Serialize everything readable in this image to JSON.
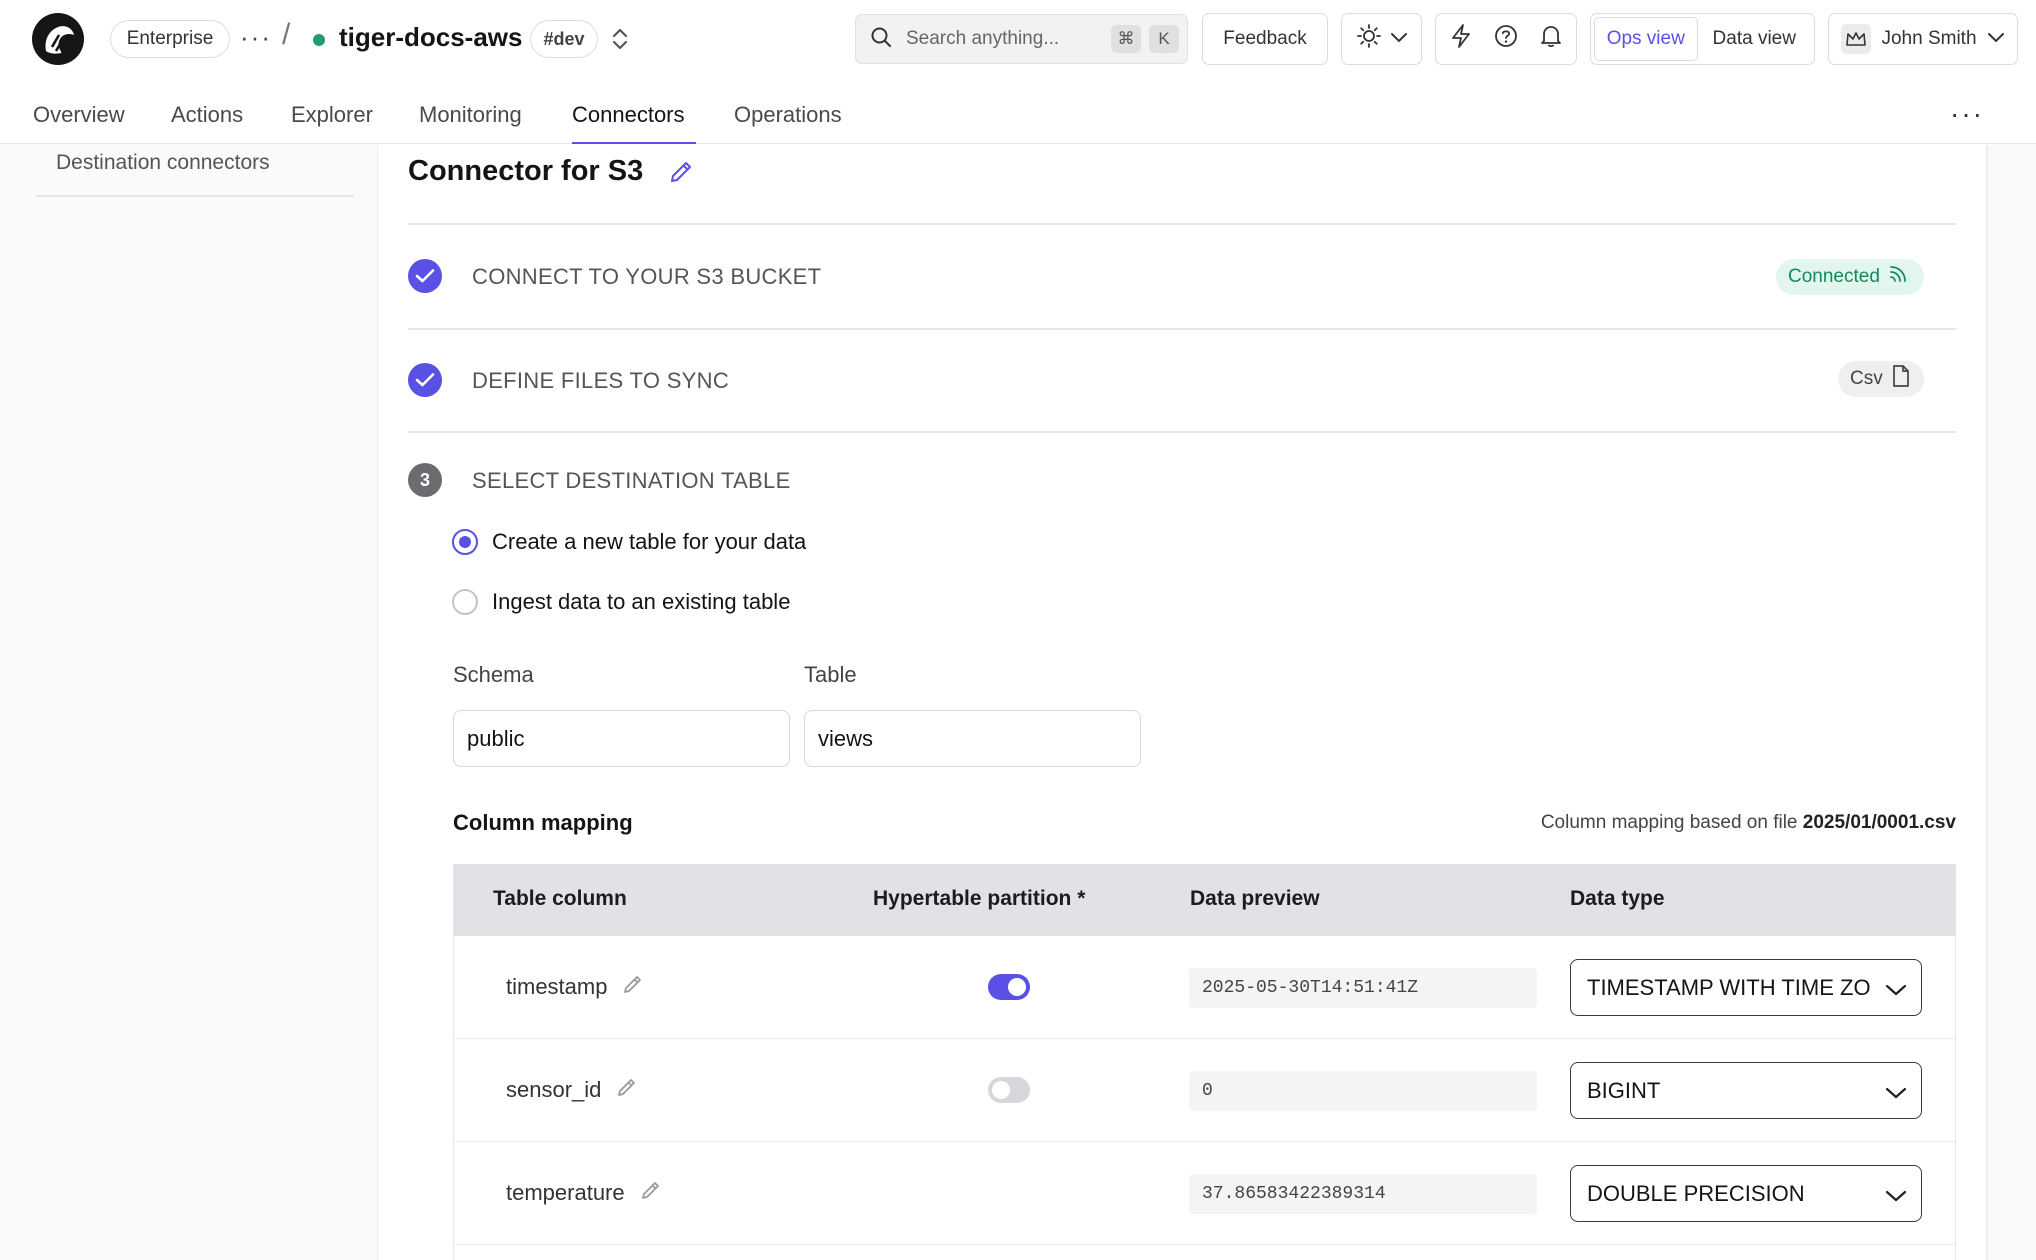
{
  "header": {
    "plan_label": "Enterprise",
    "service_name": "tiger-docs-aws",
    "env_label": "#dev",
    "search_placeholder": "Search anything...",
    "search_key_1": "⌘",
    "search_key_2": "K",
    "feedback_label": "Feedback",
    "view_ops_label": "Ops view",
    "view_data_label": "Data view",
    "user_name": "John Smith"
  },
  "tabs": [
    {
      "label": "Overview"
    },
    {
      "label": "Actions"
    },
    {
      "label": "Explorer"
    },
    {
      "label": "Monitoring"
    },
    {
      "label": "Connectors"
    },
    {
      "label": "Operations"
    }
  ],
  "sidebar": {
    "item_label": "Destination connectors"
  },
  "page": {
    "title": "Connector for S3"
  },
  "steps": [
    {
      "title": "CONNECT TO YOUR S3 BUCKET",
      "status": "done",
      "badge": "Connected"
    },
    {
      "title": "DEFINE FILES TO SYNC",
      "status": "done",
      "badge": "Csv"
    },
    {
      "number": "3",
      "title": "SELECT DESTINATION TABLE",
      "status": "active"
    }
  ],
  "destination": {
    "option_new": "Create a new table for your data",
    "option_existing": "Ingest data to an existing table",
    "schema_label": "Schema",
    "schema_value": "public",
    "table_label": "Table",
    "table_value": "views"
  },
  "column_mapping": {
    "title": "Column mapping",
    "note_prefix": "Column mapping based on file",
    "note_file": "2025/01/0001.csv",
    "headers": {
      "table_column": "Table column",
      "hypertable_partition": "Hypertable partition *",
      "data_preview": "Data preview",
      "data_type": "Data type"
    },
    "rows": [
      {
        "column": "timestamp",
        "partition": true,
        "preview": "2025-05-30T14:51:41Z",
        "type": "TIMESTAMP WITH TIME ZONE"
      },
      {
        "column": "sensor_id",
        "partition": false,
        "preview": "0",
        "type": "BIGINT"
      },
      {
        "column": "temperature",
        "preview": "37.86583422389314",
        "type": "DOUBLE PRECISION"
      }
    ]
  },
  "colors": {
    "accent": "#5a50e6",
    "success_bg": "#e3f6ee",
    "success_text": "#128a5e",
    "status_dot": "#1f9d6e"
  }
}
